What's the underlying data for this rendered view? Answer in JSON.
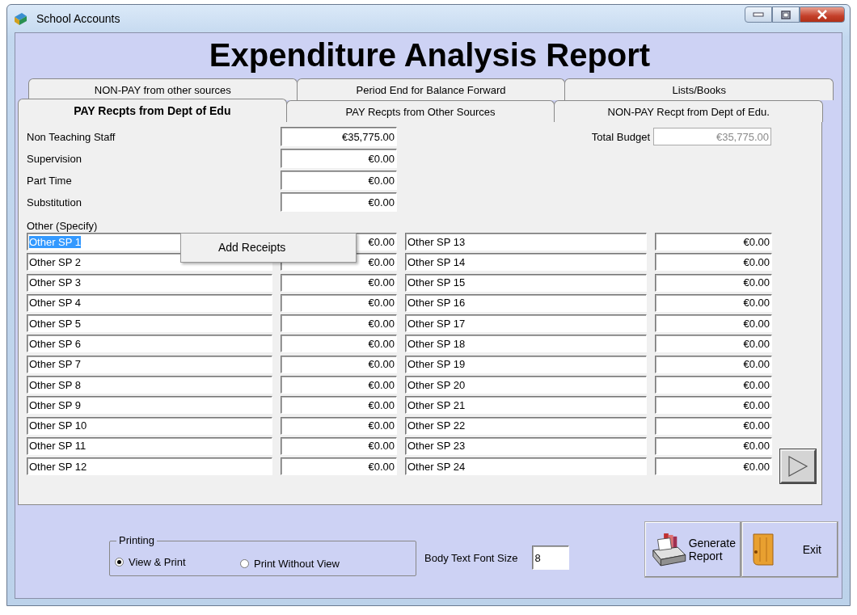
{
  "window": {
    "title": "School Accounts"
  },
  "report_title": "Expenditure Analysis Report",
  "tab_rows": [
    [
      {
        "label": "NON-PAY from other sources",
        "selected": false
      },
      {
        "label": "Period End for Balance  Forward",
        "selected": false
      },
      {
        "label": "Lists/Books",
        "selected": false
      }
    ],
    [
      {
        "label": "PAY Recpts from Dept of Edu",
        "selected": true
      },
      {
        "label": "PAY Recpts from Other Sources",
        "selected": false
      },
      {
        "label": "NON-PAY Recpt from Dept of Edu.",
        "selected": false
      }
    ]
  ],
  "fixed_fields": [
    {
      "label": "Non Teaching Staff",
      "value": "€35,775.00"
    },
    {
      "label": "Supervision",
      "value": "€0.00"
    },
    {
      "label": "Part Time",
      "value": "€0.00"
    },
    {
      "label": "Substitution",
      "value": "€0.00"
    }
  ],
  "total_budget": {
    "label": "Total Budget",
    "value": "€35,775.00",
    "disabled": true
  },
  "other_label": "Other (Specify)",
  "other_fields": [
    {
      "name": "Other SP 1",
      "amount": "€0.00",
      "highlighted": true
    },
    {
      "name": "Other SP 2",
      "amount": "€0.00",
      "highlighted": false
    },
    {
      "name": "Other SP 3",
      "amount": "€0.00",
      "highlighted": false
    },
    {
      "name": "Other SP 4",
      "amount": "€0.00",
      "highlighted": false
    },
    {
      "name": "Other SP 5",
      "amount": "€0.00",
      "highlighted": false
    },
    {
      "name": "Other SP 6",
      "amount": "€0.00",
      "highlighted": false
    },
    {
      "name": "Other SP 7",
      "amount": "€0.00",
      "highlighted": false
    },
    {
      "name": "Other SP 8",
      "amount": "€0.00",
      "highlighted": false
    },
    {
      "name": "Other SP 9",
      "amount": "€0.00",
      "highlighted": false
    },
    {
      "name": "Other SP 10",
      "amount": "€0.00",
      "highlighted": false
    },
    {
      "name": "Other SP 11",
      "amount": "€0.00",
      "highlighted": false
    },
    {
      "name": "Other SP 12",
      "amount": "€0.00",
      "highlighted": false
    },
    {
      "name": "Other SP 13",
      "amount": "€0.00",
      "highlighted": false
    },
    {
      "name": "Other SP 14",
      "amount": "€0.00",
      "highlighted": false
    },
    {
      "name": "Other SP 15",
      "amount": "€0.00",
      "highlighted": false
    },
    {
      "name": "Other SP 16",
      "amount": "€0.00",
      "highlighted": false
    },
    {
      "name": "Other SP 17",
      "amount": "€0.00",
      "highlighted": false
    },
    {
      "name": "Other SP 18",
      "amount": "€0.00",
      "highlighted": false
    },
    {
      "name": "Other SP 19",
      "amount": "€0.00",
      "highlighted": false
    },
    {
      "name": "Other SP 20",
      "amount": "€0.00",
      "highlighted": false
    },
    {
      "name": "Other SP 21",
      "amount": "€0.00",
      "highlighted": false
    },
    {
      "name": "Other SP 22",
      "amount": "€0.00",
      "highlighted": false
    },
    {
      "name": "Other SP 23",
      "amount": "€0.00",
      "highlighted": false
    },
    {
      "name": "Other SP 24",
      "amount": "€0.00",
      "highlighted": false
    }
  ],
  "context_menu": {
    "items": [
      "Add Receipts"
    ]
  },
  "printing": {
    "label": "Printing",
    "options": [
      {
        "label": "View & Print",
        "selected": true
      },
      {
        "label": "Print Without View",
        "selected": false
      }
    ]
  },
  "font_size": {
    "label": "Body Text Font Size",
    "value": "8"
  },
  "buttons": [
    {
      "kind": "print",
      "label": "Generate Report"
    },
    {
      "kind": "exit",
      "label": "Exit"
    }
  ]
}
